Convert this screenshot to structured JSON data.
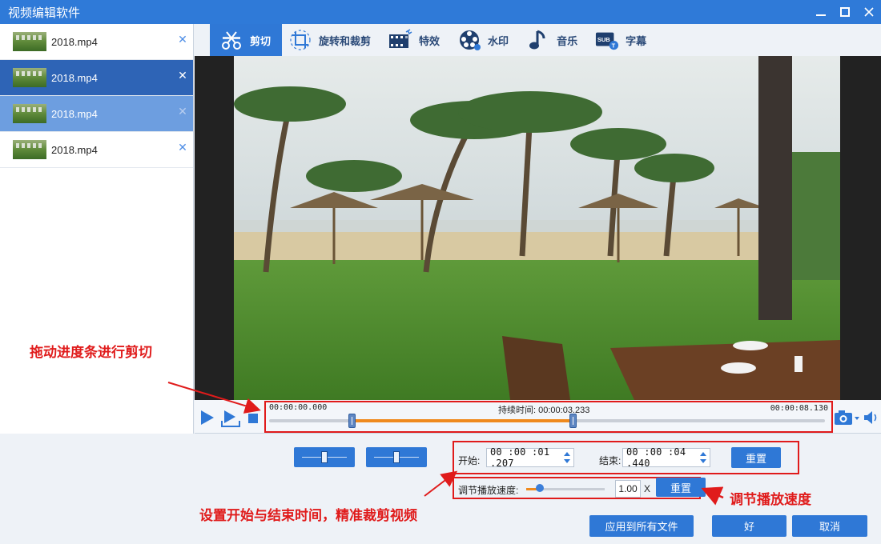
{
  "window": {
    "title": "视频编辑软件"
  },
  "files": [
    {
      "name": "2018.mp4",
      "state": "normal"
    },
    {
      "name": "2018.mp4",
      "state": "active"
    },
    {
      "name": "2018.mp4",
      "state": "hover"
    },
    {
      "name": "2018.mp4",
      "state": "normal"
    }
  ],
  "tabs": [
    {
      "label": "剪切",
      "icon": "scissors-icon",
      "active": true
    },
    {
      "label": "旋转和裁剪",
      "icon": "crop-rotate-icon",
      "active": false
    },
    {
      "label": "特效",
      "icon": "film-effects-icon",
      "active": false
    },
    {
      "label": "水印",
      "icon": "watermark-icon",
      "active": false
    },
    {
      "label": "音乐",
      "icon": "music-note-icon",
      "active": false
    },
    {
      "label": "字幕",
      "icon": "subtitle-icon",
      "active": false
    }
  ],
  "timeline": {
    "start_label": "00:00:00.000",
    "duration_label": "持续时间: 00:00:03.233",
    "end_label": "00:00:08.130",
    "total_seconds": 8.13,
    "sel_start_seconds": 1.207,
    "sel_end_seconds": 4.44
  },
  "trim": {
    "start_label": "开始:",
    "start_value": "00 :00 :01 .207",
    "end_label": "结束:",
    "end_value": "00 :00 :04 .440",
    "reset_label": "重置"
  },
  "speed": {
    "label": "调节播放速度:",
    "value": "1.00",
    "unit": "X",
    "level_fraction": 0.17,
    "reset_label": "重置"
  },
  "footer": {
    "apply_all_label": "应用到所有文件",
    "ok_label": "好",
    "cancel_label": "取消"
  },
  "annotations": {
    "drag_timeline": "拖动进度条进行剪切",
    "set_times": "设置开始与结束时间，精准裁剪视频",
    "adjust_speed": "调节播放速度"
  },
  "colors": {
    "accent": "#2f78d6",
    "highlight": "#e01b1b",
    "progress": "#ef8a1e"
  }
}
